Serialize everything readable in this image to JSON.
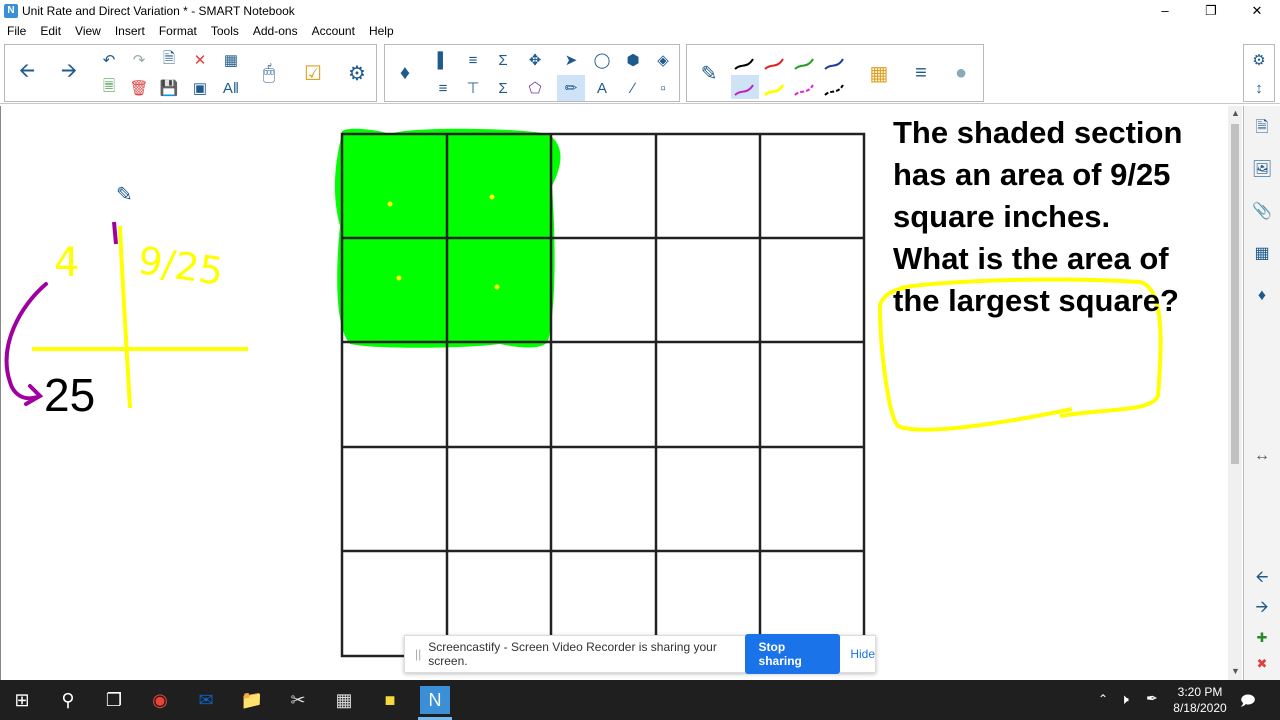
{
  "window": {
    "title": "Unit Rate and Direct Variation * - SMART Notebook"
  },
  "menu": [
    "File",
    "Edit",
    "View",
    "Insert",
    "Format",
    "Tools",
    "Add-ons",
    "Account",
    "Help"
  ],
  "canvas": {
    "question": "The shaded section has an area of 9/25 square inches. What is the area of the largest square?",
    "handwriting": {
      "left_top": "4",
      "right_top": "9/25",
      "bottom_left": "25"
    }
  },
  "share_banner": {
    "text": "Screencastify - Screen Video Recorder is sharing your screen.",
    "stop_label": "Stop sharing",
    "hide_label": "Hide"
  },
  "taskbar": {
    "time": "3:20 PM",
    "date": "8/18/2020"
  },
  "colors": {
    "shade": "#00ff00",
    "highlight": "#ffff00",
    "pen_purple": "#a000a0",
    "accent": "#1a73e8"
  }
}
